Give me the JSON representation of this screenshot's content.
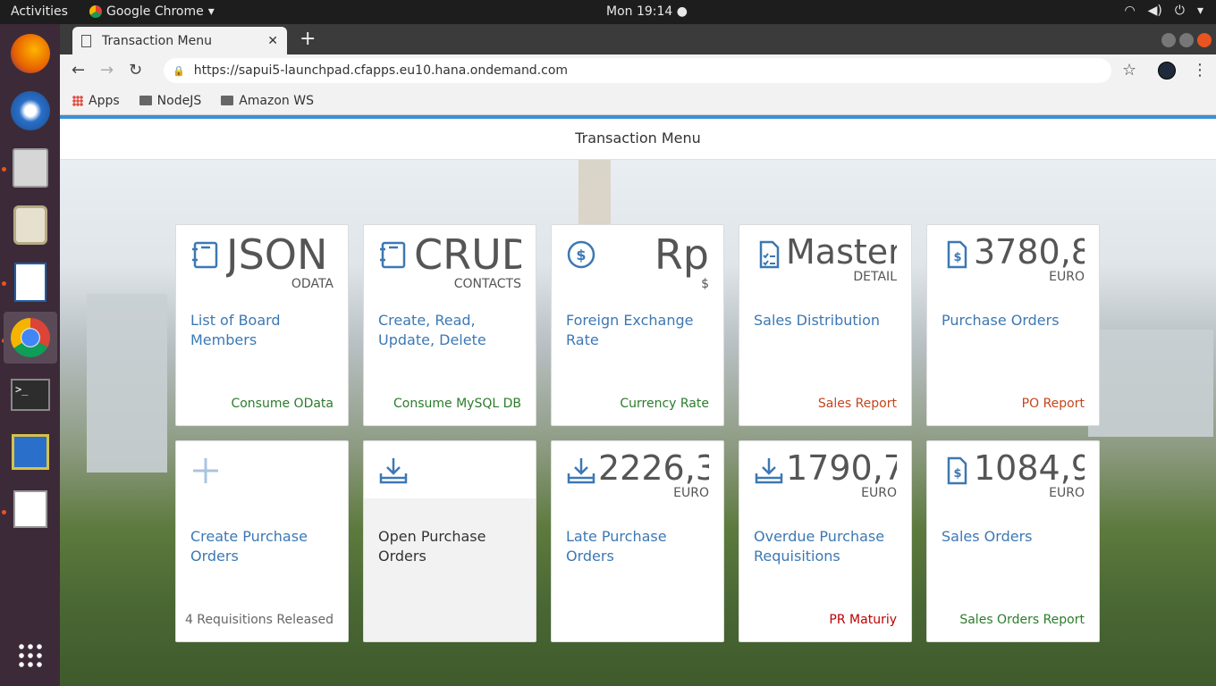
{
  "topbar": {
    "activities": "Activities",
    "app": "Google Chrome",
    "clock": "Mon 19:14"
  },
  "browser": {
    "tab_title": "Transaction Menu",
    "url": "https://sapui5-launchpad.cfapps.eu10.hana.ondemand.com",
    "bookmarks": [
      "Apps",
      "NodeJS",
      "Amazon WS"
    ]
  },
  "shell": {
    "title": "Transaction Menu"
  },
  "tiles": [
    {
      "number": "JSON",
      "unit": "ODATA",
      "title": "List of Board Members",
      "footer": "Consume OData",
      "icon": "notebook-icon"
    },
    {
      "number": "CRUD",
      "unit": "CONTACTS",
      "title": "Create, Read, Update, Delete",
      "footer": "Consume MySQL DB",
      "icon": "notebook-icon"
    },
    {
      "number": "Rp",
      "unit": "$",
      "title": "Foreign Exchange Rate",
      "footer": "Currency Rate",
      "icon": "dollar-icon"
    },
    {
      "number": "Master",
      "unit": "DETAIL",
      "title": "Sales Distribution",
      "footer": "Sales Report",
      "icon": "checklist-document-icon"
    },
    {
      "number": "3780,8",
      "unit": "EURO",
      "title": "Purchase Orders",
      "footer": "PO Report",
      "icon": "document-dollar-icon"
    },
    {
      "number": "",
      "unit": "",
      "title": "Create Purchase Orders",
      "footer": "4 Requisitions Released",
      "icon": "add-icon"
    },
    {
      "number": "",
      "unit": "",
      "title": "Open Purchase Orders",
      "footer": "",
      "icon": "download-icon"
    },
    {
      "number": "2226,3",
      "unit": "EURO",
      "title": "Late Purchase Orders",
      "footer": "",
      "icon": "download-icon"
    },
    {
      "number": "1790,7",
      "unit": "EURO",
      "title": "Overdue Purchase Requisitions",
      "footer": "PR Maturiy",
      "icon": "download-icon"
    },
    {
      "number": "1084,9",
      "unit": "EURO",
      "title": "Sales Orders",
      "footer": "Sales Orders Report",
      "icon": "document-dollar-icon"
    }
  ],
  "colors": {
    "accent": "#3c8fd6",
    "tile_text": "#3c78b4",
    "positive": "#2b7c2b",
    "critical": "#c5451c",
    "negative": "#bb0000"
  }
}
